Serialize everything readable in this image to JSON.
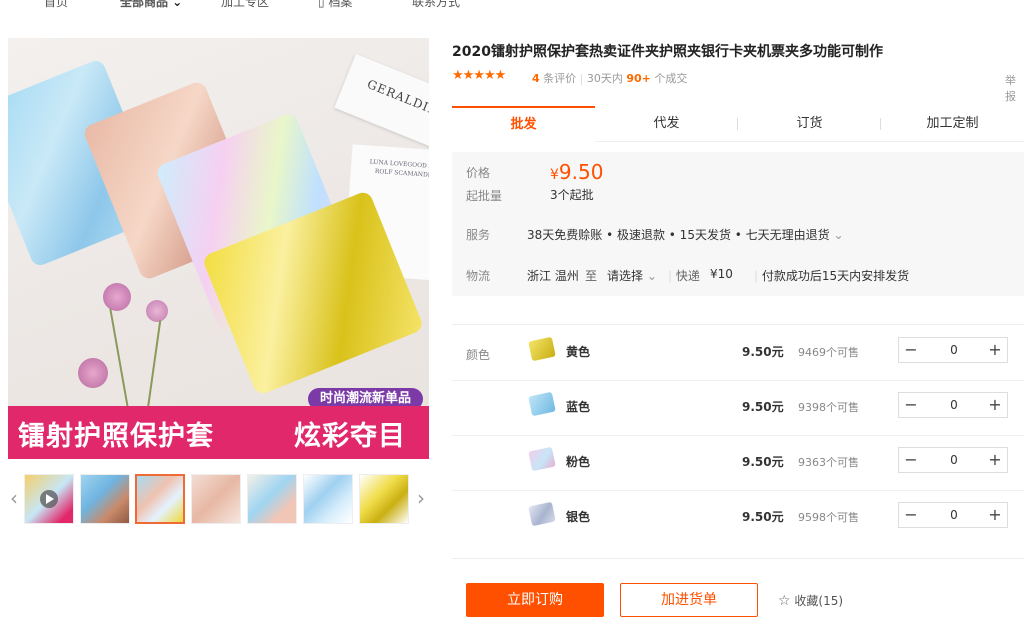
{
  "nav": {
    "items": [
      "首页",
      "全部商品",
      "加工专区",
      "档案",
      "联系方式"
    ],
    "active_index": 1
  },
  "gallery": {
    "banner_left": "镭射护照保护套",
    "banner_right": "炫彩夺目",
    "tag": "时尚潮流新单品",
    "brand_card": "GERALDINE",
    "paper_text": "LUNA LOVEGOOD AND ROLF SCAMANDER",
    "active_thumb": 2,
    "thumb_count": 7,
    "prev_arrow": "‹",
    "next_arrow": "›"
  },
  "product": {
    "title": "2020镭射护照保护套热卖证件夹护照夹银行卡夹机票夹多功能可制作",
    "stars": "★★★★★",
    "review_count": "4",
    "review_label": "条评价",
    "sold_prefix": "30天内",
    "sold_count": "90+",
    "sold_suffix": "个成交",
    "report": "举报"
  },
  "tabs": [
    "批发",
    "代发",
    "订货",
    "加工定制"
  ],
  "price": {
    "label": "价格",
    "currency": "¥",
    "value": "9.50",
    "moq_label": "起批量",
    "moq_value": "3个起批"
  },
  "service": {
    "label": "服务",
    "value": "38天免费赊账 • 极速退款 • 15天发货 • 七天无理由退货",
    "chevron": "⌄"
  },
  "logistics": {
    "label": "物流",
    "origin": "浙江 温州",
    "to": "至",
    "destination": "请选择",
    "method": "快递",
    "fee": "¥10",
    "ship_note": "付款成功后15天内安排发货"
  },
  "sku": {
    "label": "颜色",
    "rows": [
      {
        "name": "黄色",
        "price": "9.50元",
        "stock": "9469个可售",
        "qty": "0",
        "color": "#d8c31e"
      },
      {
        "name": "蓝色",
        "price": "9.50元",
        "stock": "9398个可售",
        "qty": "0",
        "color": "#7cc6e8"
      },
      {
        "name": "粉色",
        "price": "9.50元",
        "stock": "9363个可售",
        "qty": "0",
        "color": "#e7b3d6"
      },
      {
        "name": "银色",
        "price": "9.50元",
        "stock": "9598个可售",
        "qty": "0",
        "color": "#bfc7dc"
      }
    ],
    "minus": "−",
    "plus": "+"
  },
  "actions": {
    "order": "立即订购",
    "cart": "加进货单",
    "favorite_icon": "☆",
    "favorite": "收藏(15)"
  },
  "colors": {
    "accent": "#ff5000",
    "banner": "#e0286a",
    "tag": "#7c3aa7"
  }
}
